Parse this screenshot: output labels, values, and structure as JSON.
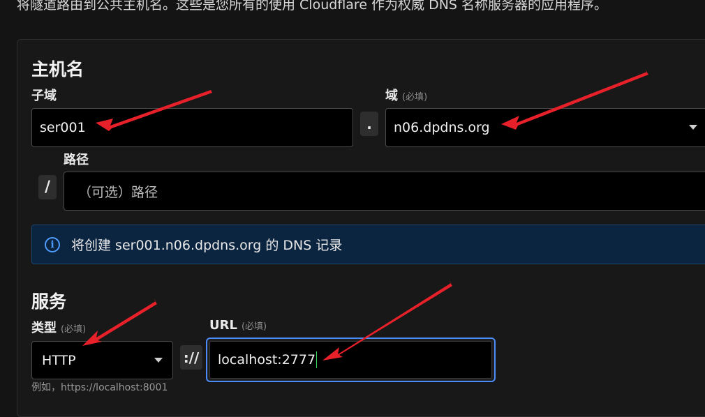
{
  "intro_text": "将隧道路由到公共主机名。这些是您所有的使用 Cloudflare 作为权威 DNS 名称服务器的应用程序。",
  "hostname": {
    "title": "主机名",
    "subdomain_label": "子域",
    "subdomain_value": "ser001",
    "dot_separator": ".",
    "domain_label": "域",
    "domain_required": "(必填)",
    "domain_value": "n06.dpdns.org",
    "path_label": "路径",
    "path_separator": "/",
    "path_placeholder": "（可选）路径"
  },
  "info_banner": {
    "icon": "info-icon",
    "text": "将创建 ser001.n06.dpdns.org 的 DNS 记录"
  },
  "service": {
    "title": "服务",
    "type_label": "类型",
    "type_required": "(必填)",
    "type_value": "HTTP",
    "type_hint": "例如，https://localhost:8001",
    "scheme_separator": "://",
    "url_label": "URL",
    "url_required": "(必填)",
    "url_value": "localhost:2777"
  },
  "colors": {
    "background": "#141414",
    "card": "#181818",
    "focus_border": "#4a8cf7",
    "info_background": "#0b2440",
    "annotation_arrow": "#e8202a"
  }
}
